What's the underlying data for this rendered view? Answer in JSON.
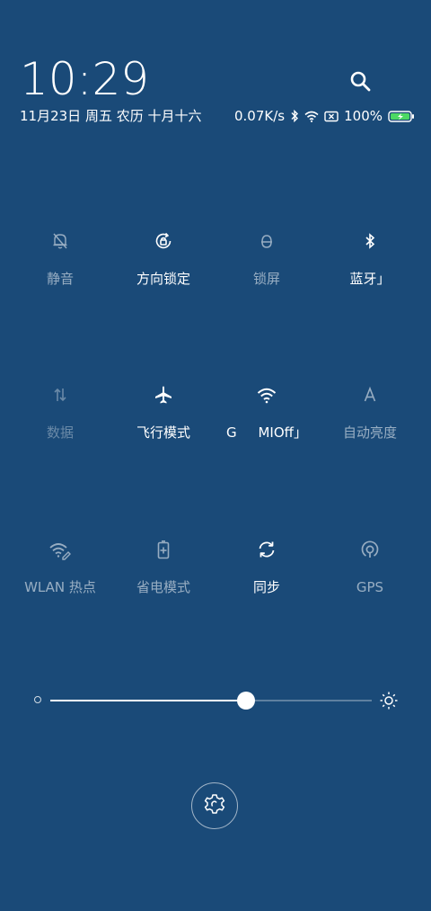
{
  "header": {
    "time": "10:29",
    "date": "11月23日 周五 农历 十月十六",
    "speed": "0.07K/s",
    "battery": "100%"
  },
  "tiles": [
    {
      "label": "静音",
      "icon": "bell-off-icon",
      "state": "off"
    },
    {
      "label": "方向锁定",
      "icon": "rotation-lock-icon",
      "state": "on"
    },
    {
      "label": "锁屏",
      "icon": "lock-icon",
      "state": "off"
    },
    {
      "label": "蓝牙」",
      "icon": "bluetooth-icon",
      "state": "on"
    },
    {
      "label": "数据",
      "icon": "mobile-data-icon",
      "state": "dim"
    },
    {
      "label": "飞行模式",
      "icon": "airplane-icon",
      "state": "on"
    },
    {
      "label": "G     MIOff」",
      "icon": "wifi-icon",
      "state": "on"
    },
    {
      "label": "自动亮度",
      "icon": "auto-brightness-icon",
      "state": "off"
    },
    {
      "label": "WLAN 热点",
      "icon": "hotspot-icon",
      "state": "off"
    },
    {
      "label": "省电模式",
      "icon": "battery-saver-icon",
      "state": "off"
    },
    {
      "label": "同步",
      "icon": "sync-icon",
      "state": "on"
    },
    {
      "label": "GPS",
      "icon": "gps-icon",
      "state": "off"
    }
  ],
  "brightness": {
    "level": 0.61
  }
}
